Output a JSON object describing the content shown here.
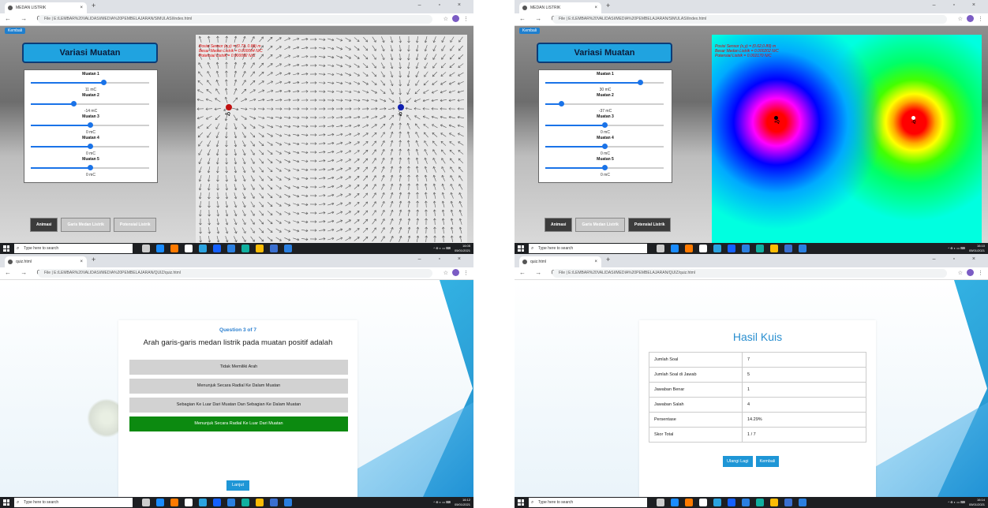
{
  "browser": {
    "sim_tab": "MEDAN LISTRIK",
    "quiz_tab": "quiz.html",
    "sim_url": "File | E:/LEMBAR%20VALIDASI/MEDIA%20PEMBELAJARAN/SIMULASI/index.html",
    "quiz_url": "File | E:/LEMBAR%20VALIDASI/MEDIA%20PEMBELAJARAN/QUIZ/quiz.html",
    "new_tab": "+",
    "close_tab": "×",
    "window_controls": "–  ▫  ×"
  },
  "taskbar": {
    "search_placeholder": "Type here to search",
    "times": [
      "16:05",
      "16:10",
      "16:12",
      "16:14"
    ],
    "date": "05/01/2021"
  },
  "sim": {
    "back_label": "Kembali",
    "title": "Variasi Muatan",
    "sliders_a": [
      {
        "label": "Muatan 1",
        "value": "11 mC",
        "level": 0.61
      },
      {
        "label": "Muatan 2",
        "value": "-14 mC",
        "level": 0.36
      },
      {
        "label": "Muatan 3",
        "value": "0 mC",
        "level": 0.5
      },
      {
        "label": "Muatan 4",
        "value": "0 mC",
        "level": 0.5
      },
      {
        "label": "Muatan 5",
        "value": "0 mC",
        "level": 0.5
      }
    ],
    "sliders_b": [
      {
        "label": "Muatan 1",
        "value": "30 mC",
        "level": 0.8
      },
      {
        "label": "Muatan 2",
        "value": "-37 mC",
        "level": 0.13
      },
      {
        "label": "Muatan 3",
        "value": "0 mC",
        "level": 0.5
      },
      {
        "label": "Muatan 4",
        "value": "0 mC",
        "level": 0.5
      },
      {
        "label": "Muatan 5",
        "value": "0 mC",
        "level": 0.5
      }
    ],
    "modes": [
      "Animasi",
      "Garis Medan Listrik",
      "Potensial Listrik"
    ],
    "readout_a": [
      "Posisi Sensor (x,y) = (0.73, 0.89) m",
      "Besar Medan Listrik = 0.000004 N/C",
      "Potensial Listrik = 0.000002 N/C"
    ],
    "readout_b": [
      "Posisi Sensor (x,y) = (0.62,0.89) m",
      "Besar Medan Listrik = 0.000202 N/C",
      "Potensial Listrik = 0.002170 N/C"
    ],
    "pos_label": "+Q",
    "neg_label": "-Q",
    "colors": {
      "positive": "#d01010",
      "negative": "#1020c0",
      "accent": "#20a3e0"
    }
  },
  "quiz": {
    "header": "Question 3 of 7",
    "question": "Arah garis-garis medan listrik pada muatan positif adalah",
    "options": [
      "Tidak Memiliki Arah",
      "Menunjuk Secara Radial Ke Dalam Muatan",
      "Sebagian Ke Luar Dari Muatan Dan Sebagian Ke Dalam Muatan",
      "Menunjuk Secara Radial Ke Luar Dari Muatan"
    ],
    "selected_index": 3,
    "next_label": "Lanjut",
    "progress": [
      "wrong",
      "wrong",
      "right",
      "empty",
      "empty",
      "empty",
      "empty"
    ],
    "wrong_mark": "✖",
    "right_mark": "✔"
  },
  "result": {
    "title": "Hasil Kuis",
    "rows": [
      {
        "label": "Jumlah Soal",
        "value": "7"
      },
      {
        "label": "Jumlah Soal di Jawab",
        "value": "5"
      },
      {
        "label": "Jawaban Benar",
        "value": "1"
      },
      {
        "label": "Jawaban Salah",
        "value": "4"
      },
      {
        "label": "Persentase",
        "value": "14.29%"
      },
      {
        "label": "Skor Total",
        "value": "1 / 7"
      }
    ],
    "retry_label": "Ulangi Lagi",
    "back_label": "Kembali"
  }
}
